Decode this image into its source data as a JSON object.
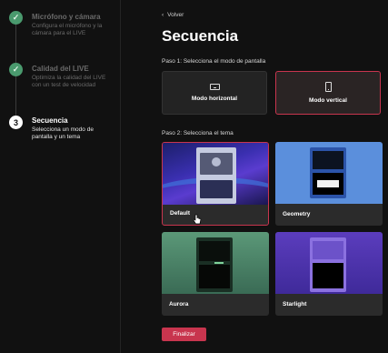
{
  "sidebar": {
    "steps": [
      {
        "status": "done",
        "icon": "check-icon",
        "title": "Micrófono y cámara",
        "description": "Configura el micrófono y la cámara para el LIVE"
      },
      {
        "status": "done",
        "icon": "check-icon",
        "title": "Calidad del LIVE",
        "description": "Optimiza la calidad del LIVE con un test de velocidad"
      },
      {
        "status": "current",
        "number": "3",
        "title": "Secuencia",
        "description": "Selecciona un modo de pantalla y un tema"
      }
    ]
  },
  "main": {
    "back_label": "Volver",
    "title": "Secuencia",
    "step1_label": "Paso 1: Selecciona el modo de pantalla",
    "modes": [
      {
        "label": "Modo horizontal",
        "icon": "horizontal-device-icon",
        "selected": false
      },
      {
        "label": "Modo vertical",
        "icon": "vertical-device-icon",
        "selected": true
      }
    ],
    "step2_label": "Paso 2: Selecciona el tema",
    "themes": [
      {
        "name": "Default",
        "selected": true
      },
      {
        "name": "Geometry",
        "selected": false
      },
      {
        "name": "Aurora",
        "selected": false
      },
      {
        "name": "Starlight",
        "selected": false
      }
    ],
    "finish_label": "Finalizar"
  },
  "colors": {
    "accent": "#c8354e",
    "done": "#4a9a6e",
    "background": "#111111"
  }
}
